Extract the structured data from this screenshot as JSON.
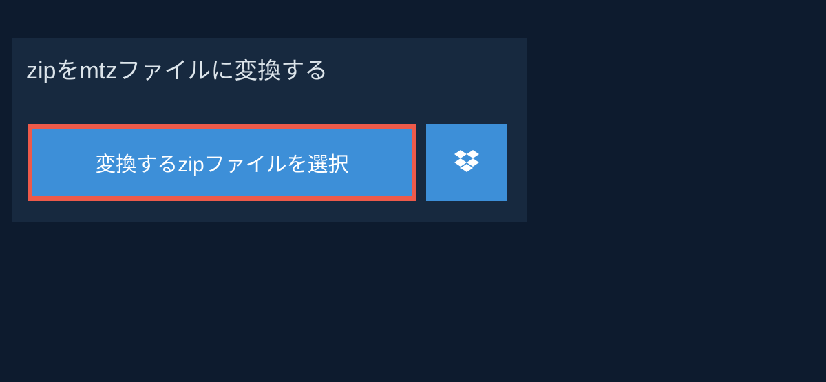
{
  "panel": {
    "title": "zipをmtzファイルに変換する",
    "select_button_label": "変換するzipファイルを選択"
  }
}
